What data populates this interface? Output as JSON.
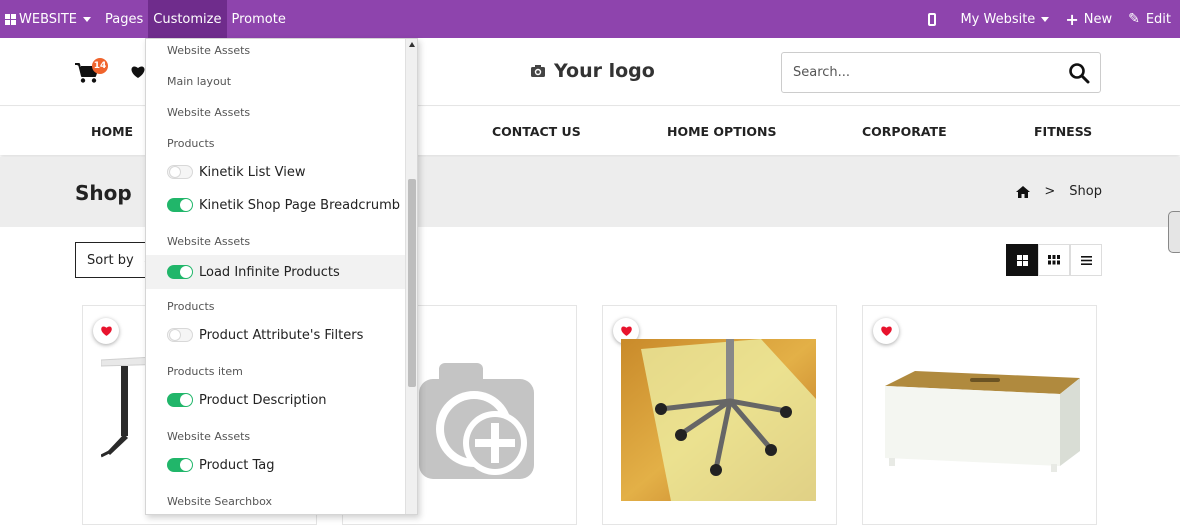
{
  "topbar": {
    "website_label": "WEBSITE",
    "pages_label": "Pages",
    "customize_label": "Customize",
    "promote_label": "Promote",
    "my_website_label": "My Website",
    "new_label": "New",
    "edit_label": "Edit",
    "bg_color": "#8e44ad"
  },
  "header": {
    "cart_count": "14",
    "logo_text": "Your logo",
    "search_placeholder": "Search..."
  },
  "nav": {
    "items": [
      "HOME",
      "CONTACT US",
      "HOME OPTIONS",
      "CORPORATE",
      "FITNESS"
    ]
  },
  "breadcrumb": {
    "title": "Shop",
    "current": "Shop",
    "separator": ">"
  },
  "toolbar": {
    "sort_label": "Sort by"
  },
  "customize_menu": {
    "rows": [
      {
        "type": "header",
        "label": "Website Assets"
      },
      {
        "type": "header",
        "label": "Main layout"
      },
      {
        "type": "header",
        "label": "Website Assets"
      },
      {
        "type": "header",
        "label": "Products"
      },
      {
        "type": "option",
        "label": "Kinetik List View",
        "enabled": false
      },
      {
        "type": "option",
        "label": "Kinetik Shop Page Breadcrumb",
        "enabled": true
      },
      {
        "type": "header",
        "label": "Website Assets"
      },
      {
        "type": "option",
        "label": "Load Infinite Products",
        "enabled": true,
        "highlighted": true
      },
      {
        "type": "header",
        "label": "Products"
      },
      {
        "type": "option",
        "label": "Product Attribute's Filters",
        "enabled": false
      },
      {
        "type": "header",
        "label": "Products item"
      },
      {
        "type": "option",
        "label": "Product Description",
        "enabled": true
      },
      {
        "type": "header",
        "label": "Website Assets"
      },
      {
        "type": "option",
        "label": "Product Tag",
        "enabled": true
      },
      {
        "type": "header",
        "label": "Website Searchbox"
      }
    ]
  },
  "colors": {
    "toggle_on": "#21b66a",
    "wishlist_heart": "#e8132d",
    "cart_badge": "#f0642d"
  }
}
